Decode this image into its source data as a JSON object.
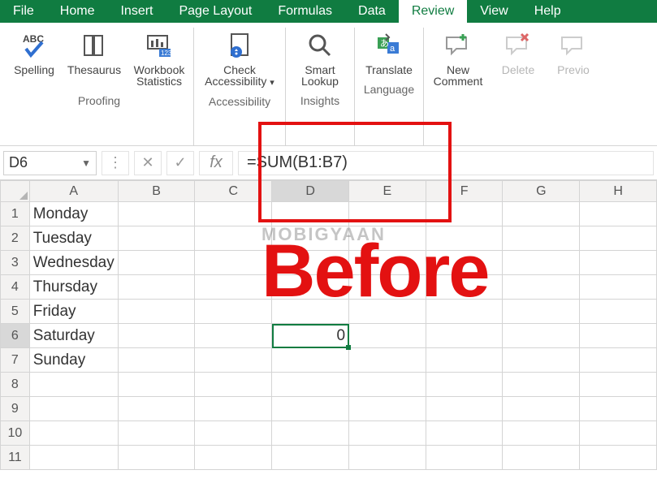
{
  "menus": [
    "File",
    "Home",
    "Insert",
    "Page Layout",
    "Formulas",
    "Data",
    "Review",
    "View",
    "Help"
  ],
  "active_menu": "Review",
  "ribbon": {
    "proofing": {
      "label": "Proofing",
      "spelling": "Spelling",
      "thesaurus": "Thesaurus",
      "workbook1": "Workbook",
      "workbook2": "Statistics"
    },
    "accessibility": {
      "label": "Accessibility",
      "check1": "Check",
      "check2": "Accessibility"
    },
    "insights": {
      "label": "Insights",
      "smart1": "Smart",
      "smart2": "Lookup"
    },
    "language": {
      "label": "Language",
      "translate": "Translate"
    },
    "comments": {
      "new1": "New",
      "new2": "Comment",
      "delete": "Delete",
      "previous": "Previo"
    }
  },
  "namebox": "D6",
  "formula": "=SUM(B1:B7)",
  "columns": [
    "A",
    "B",
    "C",
    "D",
    "E",
    "F",
    "G",
    "H"
  ],
  "selected_col": "D",
  "selected_row": 6,
  "rows": [
    {
      "n": 1,
      "A": "Monday"
    },
    {
      "n": 2,
      "A": "Tuesday"
    },
    {
      "n": 3,
      "A": "Wednesday"
    },
    {
      "n": 4,
      "A": "Thursday"
    },
    {
      "n": 5,
      "A": "Friday"
    },
    {
      "n": 6,
      "A": "Saturday",
      "D": "0"
    },
    {
      "n": 7,
      "A": "Sunday"
    },
    {
      "n": 8
    },
    {
      "n": 9
    },
    {
      "n": 10
    },
    {
      "n": 11
    }
  ],
  "overlay": {
    "watermark": "MOBIGYAAN",
    "annotation": "Before"
  }
}
